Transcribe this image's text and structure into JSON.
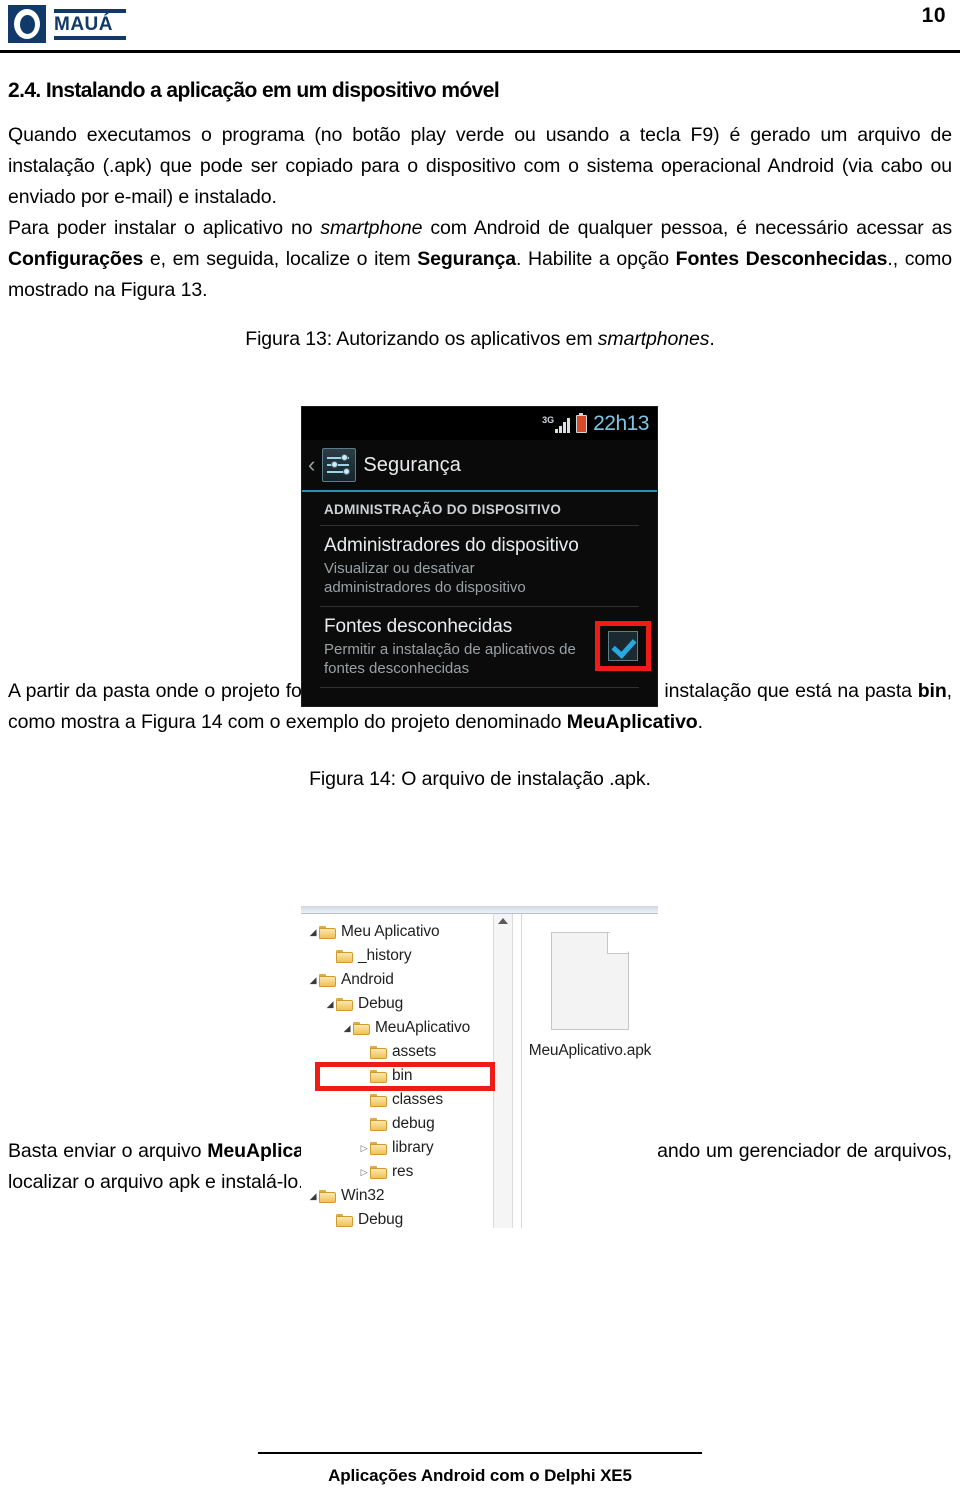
{
  "header": {
    "logo_text": "MAUÁ",
    "page_number": "10"
  },
  "section": {
    "heading": "2.4. Instalando a aplicação em um dispositivo móvel"
  },
  "paragraphs": {
    "p1_part1": "Quando executamos o programa (no botão play verde ou usando a tecla F9) é gerado um arquivo de instalação (.apk) que pode ser copiado para o dispositivo com o sistema operacional Android (via cabo ou enviado por e-mail) e instalado.",
    "p2_a": "Para poder instalar o aplicativo no ",
    "p2_b_italic": "smartphone",
    "p2_c": " com Android de qualquer pessoa, é necessário acessar as ",
    "p2_d_bold": "Configurações",
    "p2_e": " e, em seguida, localize o item ",
    "p2_f_bold": "Segurança",
    "p2_g": ". Habilite a opção ",
    "p2_h_bold": "Fontes Desconhecidas",
    "p2_i": "., como mostrado na Figura 13.",
    "p3_a": "A partir da pasta onde o projeto foi gravado, podemos acessar o arquivo de instalação que está na pasta ",
    "p3_b_bold": "bin",
    "p3_c": ", como mostra a Figura 14 com o exemplo do projeto denominado ",
    "p3_d_bold": "MeuAplicativo",
    "p3_e": ".",
    "p4_a": "Basta enviar o arquivo ",
    "p4_b_bold": "MeuAplicativo.apk",
    "p4_c": " para o dispositivo móvel e, utilizando um gerenciador de arquivos, localizar o arquivo apk e instalá-lo."
  },
  "figure13": {
    "caption_a": "Figura 13: Autorizando os aplicativos em ",
    "caption_b_italic": "smartphones",
    "caption_c": ".",
    "statusbar": {
      "network": "3G",
      "clock": "22h13"
    },
    "title": "Segurança",
    "section_label": "ADMINISTRAÇÃO DO DISPOSITIVO",
    "rows": [
      {
        "title": "Administradores do dispositivo",
        "sub": "Visualizar ou desativar administradores do dispositivo"
      },
      {
        "title": "Fontes desconhecidas",
        "sub": "Permitir a instalação de aplicativos de fontes desconhecidas"
      }
    ],
    "checkbox_checked": true,
    "highlight_color": "#ee1b18",
    "accent_color": "#2a8fb5"
  },
  "figure14": {
    "caption": "Figura 14: O arquivo de instalação .apk.",
    "tree": [
      {
        "label": "Meu Aplicativo",
        "indent": 0,
        "expander": "open"
      },
      {
        "label": "_history",
        "indent": 1,
        "expander": "none"
      },
      {
        "label": "Android",
        "indent": 0,
        "expander": "open"
      },
      {
        "label": "Debug",
        "indent": 1,
        "expander": "open"
      },
      {
        "label": "MeuAplicativo",
        "indent": 2,
        "expander": "open"
      },
      {
        "label": "assets",
        "indent": 3,
        "expander": "none"
      },
      {
        "label": "bin",
        "indent": 3,
        "expander": "none",
        "highlighted": true
      },
      {
        "label": "classes",
        "indent": 3,
        "expander": "none"
      },
      {
        "label": "debug",
        "indent": 3,
        "expander": "none"
      },
      {
        "label": "library",
        "indent": 3,
        "expander": "closed"
      },
      {
        "label": "res",
        "indent": 3,
        "expander": "closed"
      },
      {
        "label": "Win32",
        "indent": 0,
        "expander": "open"
      },
      {
        "label": "Debug",
        "indent": 1,
        "expander": "none"
      }
    ],
    "file_label": "MeuAplicativo.apk",
    "highlight_color": "#ee1b18"
  },
  "footer": {
    "text": "Aplicações Android com o Delphi XE5"
  }
}
